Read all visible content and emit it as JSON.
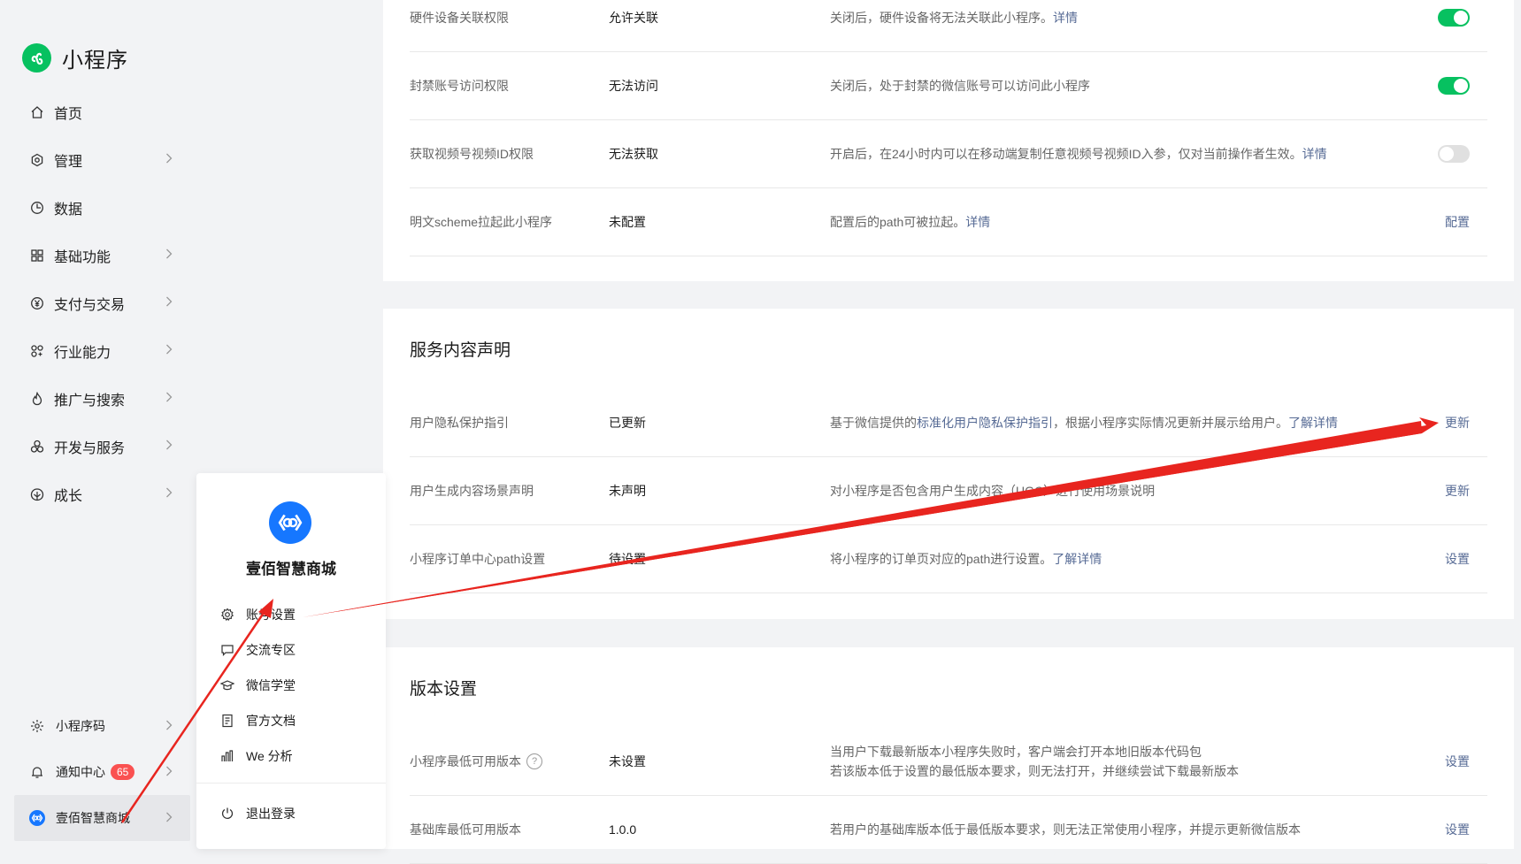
{
  "app": {
    "logo_text": "小程序"
  },
  "sidebar": {
    "items": [
      {
        "label": "首页",
        "icon": "home-icon",
        "has_chevron": false
      },
      {
        "label": "管理",
        "icon": "settings-icon",
        "has_chevron": true
      },
      {
        "label": "数据",
        "icon": "pie-chart-icon",
        "has_chevron": false
      },
      {
        "label": "基础功能",
        "icon": "grid-icon",
        "has_chevron": true
      },
      {
        "label": "支付与交易",
        "icon": "yen-icon",
        "has_chevron": true
      },
      {
        "label": "行业能力",
        "icon": "industry-icon",
        "has_chevron": true
      },
      {
        "label": "推广与搜索",
        "icon": "flame-icon",
        "has_chevron": true
      },
      {
        "label": "开发与服务",
        "icon": "dev-icon",
        "has_chevron": true
      },
      {
        "label": "成长",
        "icon": "growth-icon",
        "has_chevron": true
      }
    ],
    "bottom": {
      "qrcode_label": "小程序码",
      "notify_label": "通知中心",
      "notify_count": "65",
      "account_label": "壹佰智慧商城"
    }
  },
  "popup": {
    "name": "壹佰智慧商城",
    "items": [
      {
        "label": "账号设置",
        "icon": "gear-icon"
      },
      {
        "label": "交流专区",
        "icon": "chat-icon"
      },
      {
        "label": "微信学堂",
        "icon": "graduation-cap-icon"
      },
      {
        "label": "官方文档",
        "icon": "document-icon"
      },
      {
        "label": "We 分析",
        "icon": "analytics-icon"
      }
    ],
    "logout_label": "退出登录"
  },
  "card1": {
    "rows": [
      {
        "name": "硬件设备关联权限",
        "status": "允许关联",
        "desc": "关闭后，硬件设备将无法关联此小程序。",
        "link": "详情",
        "control": "toggle",
        "on": true
      },
      {
        "name": "封禁账号访问权限",
        "status": "无法访问",
        "desc": "关闭后，处于封禁的微信账号可以访问此小程序",
        "link": "",
        "control": "toggle",
        "on": true
      },
      {
        "name": "获取视频号视频ID权限",
        "status": "无法获取",
        "desc": "开启后，在24小时内可以在移动端复制任意视频号视频ID入参，仅对当前操作者生效。",
        "link": "详情",
        "control": "toggle",
        "on": false
      },
      {
        "name": "明文scheme拉起此小程序",
        "status": "未配置",
        "desc": "配置后的path可被拉起。",
        "link": "详情",
        "control": "action",
        "action": "配置"
      }
    ]
  },
  "card2": {
    "title": "服务内容声明",
    "rows": [
      {
        "name": "用户隐私保护指引",
        "status": "已更新",
        "desc_pre": "基于微信提供的",
        "desc_link": "标准化用户隐私保护指引",
        "desc_post": "，根据小程序实际情况更新并展示给用户。",
        "link": "了解详情",
        "action": "更新"
      },
      {
        "name": "用户生成内容场景声明",
        "status": "未声明",
        "desc": "对小程序是否包含用户生成内容（UGC）进行使用场景说明",
        "action": "更新"
      },
      {
        "name": "小程序订单中心path设置",
        "status": "待设置",
        "desc": "将小程序的订单页对应的path进行设置。",
        "link": "了解详情",
        "action": "设置"
      }
    ]
  },
  "card3": {
    "title": "版本设置",
    "rows": [
      {
        "name": "小程序最低可用版本",
        "status": "未设置",
        "desc_line1": "当用户下载最新版本小程序失败时，客户端会打开本地旧版本代码包",
        "desc_line2": "若该版本低于设置的最低版本要求，则无法打开，并继续尝试下载最新版本",
        "action": "设置"
      },
      {
        "name": "基础库最低可用版本",
        "status": "1.0.0",
        "desc": "若用户的基础库版本低于最低版本要求，则无法正常使用小程序，并提示更新微信版本",
        "action": "设置"
      }
    ]
  },
  "colors": {
    "accent_green": "#07c160",
    "link_blue": "#576b95",
    "badge_red": "#fa5151",
    "arrow_red": "#e8251f"
  }
}
